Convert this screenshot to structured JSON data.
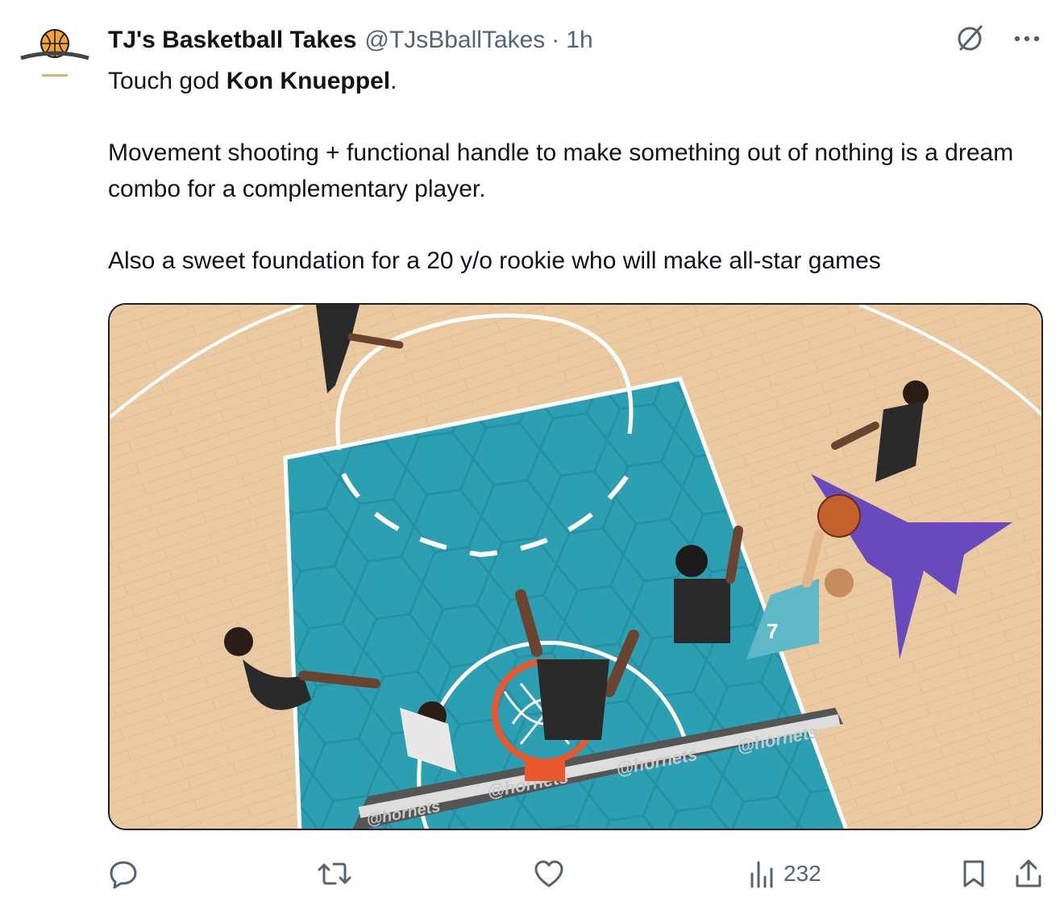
{
  "tweet": {
    "author_name": "TJ's Basketball Takes",
    "handle": "@TJsBballTakes",
    "separator": "·",
    "time": "1h",
    "text": {
      "line1_prefix": "Touch god ",
      "line1_bold": "Kon Knueppel",
      "line1_suffix": ".",
      "paragraph2": "Movement shooting + functional handle to make something out of nothing is a dream combo for a complementary player.",
      "paragraph3": "Also a sweet foundation for a 20 y/o rookie who will make all-star games"
    },
    "media": {
      "court_watermarks": [
        "@hornets",
        "@hornets",
        "@hornets",
        "@hornets"
      ],
      "player_number": "7"
    },
    "actions": {
      "views": "232"
    }
  },
  "icons": {
    "grok": "grok-icon",
    "more": "more-icon",
    "reply": "reply-icon",
    "retweet": "retweet-icon",
    "like": "like-icon",
    "views": "views-icon",
    "bookmark": "bookmark-icon",
    "share": "share-icon"
  },
  "colors": {
    "text": "#0f1419",
    "secondary": "#536471",
    "paint_teal": "#2a9db0",
    "court_wood": "#e9c9a0"
  }
}
